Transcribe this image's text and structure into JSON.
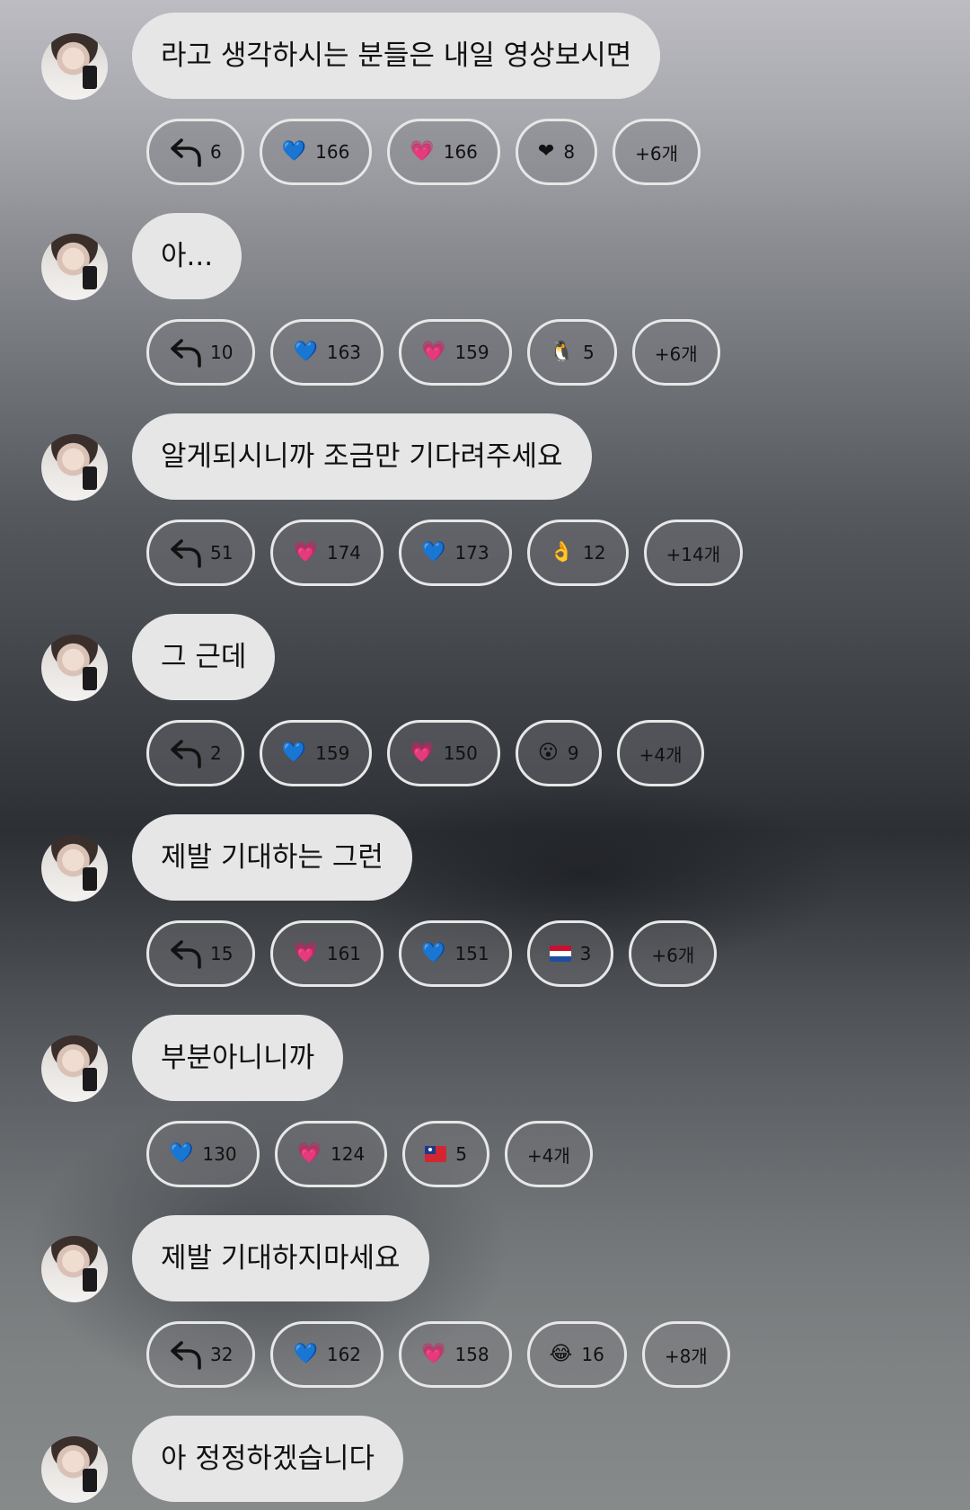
{
  "messages": [
    {
      "text": "라고 생각하시는 분들은 내일 영상보시면",
      "reactions": [
        {
          "type": "reply",
          "icon": "reply-arrow-icon",
          "count": "6"
        },
        {
          "type": "emoji",
          "icon": "blue-heart-icon",
          "emoji": "💙",
          "count": "166"
        },
        {
          "type": "emoji",
          "icon": "pink-heart-icon",
          "emoji": "💗",
          "count": "166"
        },
        {
          "type": "emoji",
          "icon": "black-heart-icon",
          "emoji": "❤",
          "count": "8"
        },
        {
          "type": "more",
          "label": "+6개"
        }
      ]
    },
    {
      "text": "아...",
      "reactions": [
        {
          "type": "reply",
          "icon": "reply-arrow-icon",
          "count": "10"
        },
        {
          "type": "emoji",
          "icon": "blue-heart-icon",
          "emoji": "💙",
          "count": "163"
        },
        {
          "type": "emoji",
          "icon": "pink-heart-icon",
          "emoji": "💗",
          "count": "159"
        },
        {
          "type": "emoji",
          "icon": "penguin-icon",
          "emoji": "🐧",
          "count": "5"
        },
        {
          "type": "more",
          "label": "+6개"
        }
      ]
    },
    {
      "text": "알게되시니까 조금만 기다려주세요",
      "reactions": [
        {
          "type": "reply",
          "icon": "reply-arrow-icon",
          "count": "51"
        },
        {
          "type": "emoji",
          "icon": "pink-heart-icon",
          "emoji": "💗",
          "count": "174"
        },
        {
          "type": "emoji",
          "icon": "blue-heart-icon",
          "emoji": "💙",
          "count": "173"
        },
        {
          "type": "emoji",
          "icon": "ok-hand-icon",
          "emoji": "👌",
          "count": "12"
        },
        {
          "type": "more",
          "label": "+14개"
        }
      ]
    },
    {
      "text": "그 근데",
      "reactions": [
        {
          "type": "reply",
          "icon": "reply-arrow-icon",
          "count": "2"
        },
        {
          "type": "emoji",
          "icon": "blue-heart-icon",
          "emoji": "💙",
          "count": "159"
        },
        {
          "type": "emoji",
          "icon": "pink-heart-icon",
          "emoji": "💗",
          "count": "150"
        },
        {
          "type": "emoji",
          "icon": "surprised-face-icon",
          "emoji": "😮",
          "count": "9"
        },
        {
          "type": "more",
          "label": "+4개"
        }
      ]
    },
    {
      "text": "제발 기대하는 그런",
      "reactions": [
        {
          "type": "reply",
          "icon": "reply-arrow-icon",
          "count": "15"
        },
        {
          "type": "emoji",
          "icon": "pink-heart-icon",
          "emoji": "💗",
          "count": "161"
        },
        {
          "type": "emoji",
          "icon": "blue-heart-icon",
          "emoji": "💙",
          "count": "151"
        },
        {
          "type": "flag-nl",
          "icon": "netherlands-flag-icon",
          "count": "3"
        },
        {
          "type": "more",
          "label": "+6개"
        }
      ]
    },
    {
      "text": "부분아니니까",
      "reactions": [
        {
          "type": "emoji",
          "icon": "blue-heart-icon",
          "emoji": "💙",
          "count": "130"
        },
        {
          "type": "emoji",
          "icon": "pink-heart-icon",
          "emoji": "💗",
          "count": "124"
        },
        {
          "type": "flag-tw",
          "icon": "taiwan-flag-icon",
          "count": "5"
        },
        {
          "type": "more",
          "label": "+4개"
        }
      ]
    },
    {
      "text": "제발 기대하지마세요",
      "reactions": [
        {
          "type": "reply",
          "icon": "reply-arrow-icon",
          "count": "32"
        },
        {
          "type": "emoji",
          "icon": "blue-heart-icon",
          "emoji": "💙",
          "count": "162"
        },
        {
          "type": "emoji",
          "icon": "pink-heart-icon",
          "emoji": "💗",
          "count": "158"
        },
        {
          "type": "emoji",
          "icon": "tears-of-joy-icon",
          "emoji": "😂",
          "count": "16"
        },
        {
          "type": "more",
          "label": "+8개"
        }
      ]
    },
    {
      "text": "아 정정하겠습니다",
      "reactions": []
    }
  ]
}
